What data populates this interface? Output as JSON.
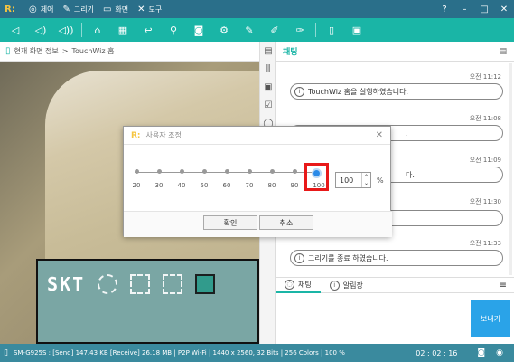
{
  "app": {
    "menu": [
      {
        "label": "제어",
        "icon": "control-icon"
      },
      {
        "label": "그리기",
        "icon": "pencil-icon"
      },
      {
        "label": "화면",
        "icon": "monitor-icon"
      },
      {
        "label": "도구",
        "icon": "tools-icon"
      }
    ],
    "window_buttons": [
      "?",
      "–",
      "□",
      "✕"
    ]
  },
  "toolbar": {
    "icons": [
      "volume-mute-icon",
      "volume-down-icon",
      "volume-up-icon",
      "home-icon",
      "apps-icon",
      "back-icon",
      "search-icon",
      "camera-icon",
      "settings-icon",
      "pen-icon",
      "stylus-icon",
      "brush-icon",
      "phone-icon",
      "phone-alt-icon"
    ]
  },
  "breadcrumb": {
    "root": "현재 화면 정보",
    "separator": ">",
    "current": "TouchWiz 홈"
  },
  "phone_screen": {
    "carrier": "SKT"
  },
  "chat": {
    "title": "채팅",
    "messages": [
      {
        "time": "오전 11:12",
        "text": "TouchWiz 홈을 실행하였습니다."
      },
      {
        "time": "오전 11:08",
        "text": "."
      },
      {
        "time": "오전 11:09",
        "text": "다."
      },
      {
        "time": "오전 11:30",
        "text": ""
      },
      {
        "time": "오전 11:33",
        "text": "그리기를 종료 하였습니다."
      }
    ],
    "tabs": [
      {
        "label": "채팅",
        "active": true
      },
      {
        "label": "알림장",
        "active": false
      }
    ],
    "send_label": "보내기"
  },
  "statusbar": {
    "info": "SM-G925S : [Send] 147.43 KB  [Receive] 26.18 MB | P2P Wi-Fi | 1440 x 2560, 32 Bits | 256 Colors | 100 %",
    "timer": "02 : 02 : 16"
  },
  "modal": {
    "title": "사용자 조정",
    "ticks": [
      "20",
      "30",
      "40",
      "50",
      "60",
      "70",
      "80",
      "90",
      "100"
    ],
    "selected": "100",
    "zoom_value": "100",
    "zoom_unit": "%",
    "confirm_label": "확인",
    "cancel_label": "취소"
  },
  "colors": {
    "titlebar": "#2a6f8a",
    "toolbar": "#1ab5a6",
    "send": "#2aa3e8",
    "highlight": "#e81919",
    "statusbar": "#3a8a9e"
  }
}
